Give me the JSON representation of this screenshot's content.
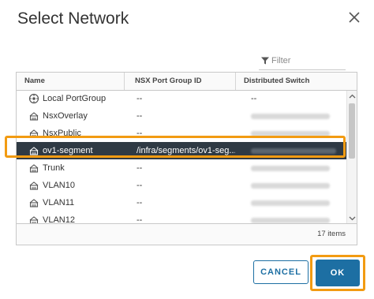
{
  "dialog": {
    "title": "Select Network",
    "close_icon": "close-icon"
  },
  "filter": {
    "placeholder": "Filter",
    "value": "",
    "icon": "funnel-icon"
  },
  "table": {
    "columns": [
      "Name",
      "NSX Port Group ID",
      "Distributed Switch"
    ],
    "rows": [
      {
        "name": "Local PortGroup",
        "nsx_id": "--",
        "switch": "--",
        "icon": "portgroup-icon"
      },
      {
        "name": "NsxOverlay",
        "nsx_id": "--",
        "switch": "",
        "icon": "network-icon"
      },
      {
        "name": "NsxPublic",
        "nsx_id": "--",
        "switch": "",
        "icon": "network-icon"
      },
      {
        "name": "ov1-segment",
        "nsx_id": "/infra/segments/ov1-seg...",
        "switch": "",
        "icon": "network-icon",
        "selected": true
      },
      {
        "name": "Trunk",
        "nsx_id": "--",
        "switch": "",
        "icon": "network-icon"
      },
      {
        "name": "VLAN10",
        "nsx_id": "--",
        "switch": "",
        "icon": "network-icon"
      },
      {
        "name": "VLAN11",
        "nsx_id": "--",
        "switch": "",
        "icon": "network-icon"
      },
      {
        "name": "VLAN12",
        "nsx_id": "--",
        "switch": "",
        "icon": "network-icon"
      }
    ],
    "item_count": "17 items"
  },
  "buttons": {
    "cancel": "CANCEL",
    "ok": "OK"
  },
  "colors": {
    "accent": "#1d6fa3",
    "highlight": "#f29b12",
    "selected_row": "#2f3a44"
  }
}
